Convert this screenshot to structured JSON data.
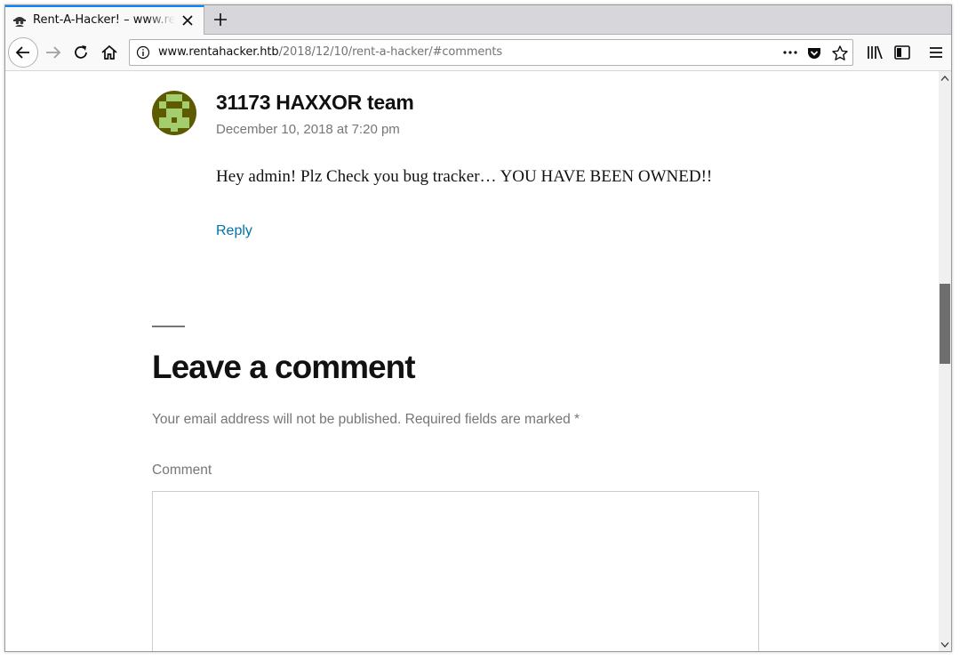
{
  "browser": {
    "tab": {
      "title": "Rent-A-Hacker! – www.rentahacker.htb",
      "favicon": "hacker-spy-icon"
    },
    "url": {
      "host": "www.rentahacker.htb",
      "path": "/2018/12/10/rent-a-hacker/#comments"
    },
    "accent_color": "#0a84ff"
  },
  "comment": {
    "author": "31173 HAXXOR team",
    "date": "December 10, 2018 at 7:20 pm",
    "text": "Hey admin! Plz Check you bug tracker… YOU HAVE BEEN OWNED!!",
    "reply_label": "Reply",
    "avatar_colors": {
      "light": "#a4cd6e",
      "dark": "#5d5a00"
    }
  },
  "respond": {
    "title": "Leave a comment",
    "notes": "Your email address will not be published. Required fields are marked *",
    "comment_label": "Comment",
    "comment_value": ""
  },
  "colors": {
    "link": "#0073aa",
    "muted_text": "#767676"
  }
}
